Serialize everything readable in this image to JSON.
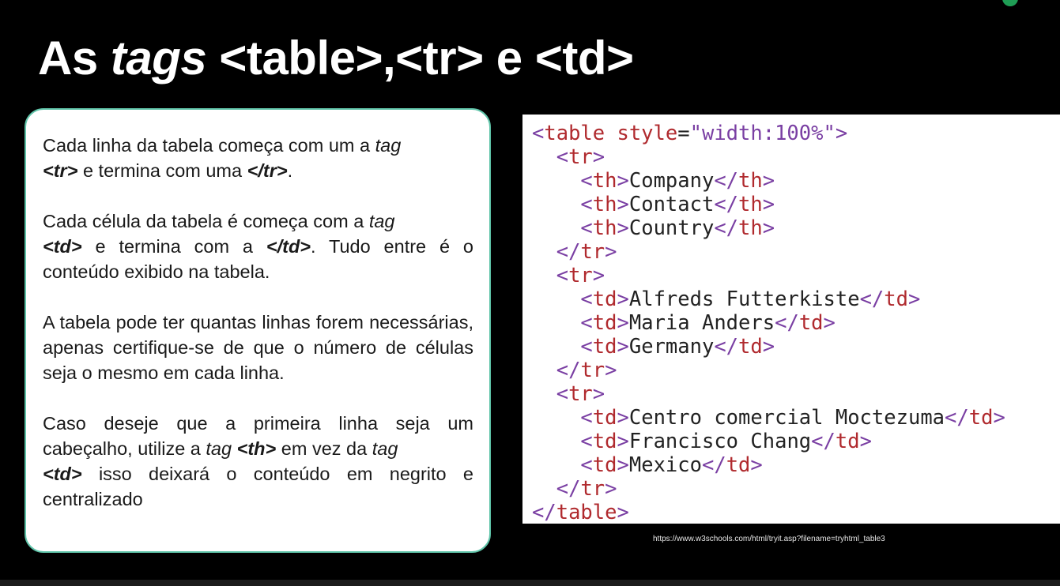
{
  "slide": {
    "title_parts": {
      "p1": "As ",
      "p2": "tags",
      "p3": " <table>,<tr> e <td>"
    }
  },
  "explanation": {
    "para1": {
      "t1": "Cada linha da tabela começa com um a ",
      "t2": "tag",
      "t3": "",
      "t4": "<tr>",
      "t5": " e termina com uma ",
      "t6": "</tr>",
      "t7": "."
    },
    "para2": {
      "t1": "Cada célula da tabela é começa com a ",
      "t2": "tag",
      "t3": "<td>",
      "t4": " e termina com a ",
      "t5": "</td>",
      "t6": ". Tudo entre é o conteúdo exibido na tabela."
    },
    "para3": {
      "t1": "A tabela pode ter quantas linhas forem necessárias, apenas certifique-se de que o número de células seja o mesmo em cada linha."
    },
    "para4": {
      "t1": "Caso deseje que a primeira linha seja um cabeçalho, utilize a ",
      "t2": "tag",
      "t3": "<th>",
      "t4": " em vez da ",
      "t5": "tag",
      "t6": "<td>",
      "t7": " isso deixará o conteúdo em negrito e centralizado"
    }
  },
  "code_example": {
    "lines": [
      {
        "indent": "",
        "open": "table",
        "attr": " style",
        "eq": "=",
        "val": "\"width:100%\"",
        "text": "",
        "close": ""
      },
      {
        "indent": "  ",
        "open": "tr",
        "attr": "",
        "eq": "",
        "val": "",
        "text": "",
        "close": ""
      },
      {
        "indent": "    ",
        "open": "th",
        "attr": "",
        "eq": "",
        "val": "",
        "text": "Company",
        "close": "th"
      },
      {
        "indent": "    ",
        "open": "th",
        "attr": "",
        "eq": "",
        "val": "",
        "text": "Contact",
        "close": "th"
      },
      {
        "indent": "    ",
        "open": "th",
        "attr": "",
        "eq": "",
        "val": "",
        "text": "Country",
        "close": "th"
      },
      {
        "indent": "  ",
        "open": "",
        "attr": "",
        "eq": "",
        "val": "",
        "text": "",
        "close": "tr"
      },
      {
        "indent": "  ",
        "open": "tr",
        "attr": "",
        "eq": "",
        "val": "",
        "text": "",
        "close": ""
      },
      {
        "indent": "    ",
        "open": "td",
        "attr": "",
        "eq": "",
        "val": "",
        "text": "Alfreds Futterkiste",
        "close": "td"
      },
      {
        "indent": "    ",
        "open": "td",
        "attr": "",
        "eq": "",
        "val": "",
        "text": "Maria Anders",
        "close": "td"
      },
      {
        "indent": "    ",
        "open": "td",
        "attr": "",
        "eq": "",
        "val": "",
        "text": "Germany",
        "close": "td"
      },
      {
        "indent": "  ",
        "open": "",
        "attr": "",
        "eq": "",
        "val": "",
        "text": "",
        "close": "tr"
      },
      {
        "indent": "  ",
        "open": "tr",
        "attr": "",
        "eq": "",
        "val": "",
        "text": "",
        "close": ""
      },
      {
        "indent": "    ",
        "open": "td",
        "attr": "",
        "eq": "",
        "val": "",
        "text": "Centro comercial Moctezuma",
        "close": "td"
      },
      {
        "indent": "    ",
        "open": "td",
        "attr": "",
        "eq": "",
        "val": "",
        "text": "Francisco Chang",
        "close": "td"
      },
      {
        "indent": "    ",
        "open": "td",
        "attr": "",
        "eq": "",
        "val": "",
        "text": "Mexico",
        "close": "td"
      },
      {
        "indent": "  ",
        "open": "",
        "attr": "",
        "eq": "",
        "val": "",
        "text": "",
        "close": "tr"
      },
      {
        "indent": "",
        "open": "",
        "attr": "",
        "eq": "",
        "val": "",
        "text": "",
        "close": "table"
      }
    ]
  },
  "source": {
    "url": "https://www.w3schools.com/html/tryit.asp?filename=tryhtml_table3"
  },
  "colors": {
    "background": "#000000",
    "card_border": "#5fc4a9",
    "tag_name": "#b02a2e",
    "angle_bracket": "#7a3fa3",
    "accent_dot": "#1f9d55"
  }
}
